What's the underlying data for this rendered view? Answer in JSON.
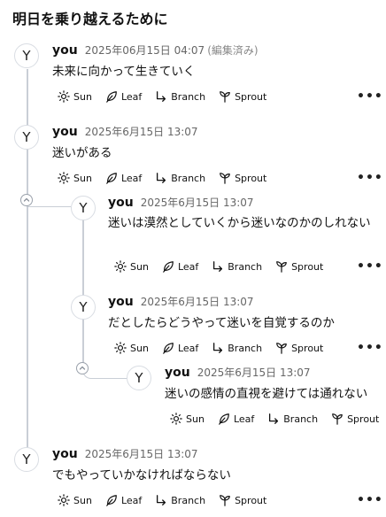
{
  "page": {
    "title": "明日を乗り越えるために"
  },
  "actions": {
    "sun": "Sun",
    "leaf": "Leaf",
    "branch": "Branch",
    "sprout": "Sprout",
    "more": "•••"
  },
  "comments": [
    {
      "avatar": "Y",
      "author": "you",
      "timestamp": "2025年06月15日 04:07",
      "edited": "(編集済み)",
      "text": "未来に向かって生きていく"
    },
    {
      "avatar": "Y",
      "author": "you",
      "timestamp": "2025年6月15日 13:07",
      "text": "迷いがある"
    },
    {
      "avatar": "Y",
      "author": "you",
      "timestamp": "2025年6月15日 13:07",
      "text": "迷いは漠然としていくから迷いなのかのしれない"
    },
    {
      "avatar": "Y",
      "author": "you",
      "timestamp": "2025年6月15日 13:07",
      "text": "だとしたらどうやって迷いを自覚するのか"
    },
    {
      "avatar": "Y",
      "author": "you",
      "timestamp": "2025年6月15日 13:07",
      "text": "迷いの感情の直視を避けては通れない"
    },
    {
      "avatar": "Y",
      "author": "you",
      "timestamp": "2025年6月15日 13:07",
      "text": "でもやっていかなければならない"
    }
  ]
}
